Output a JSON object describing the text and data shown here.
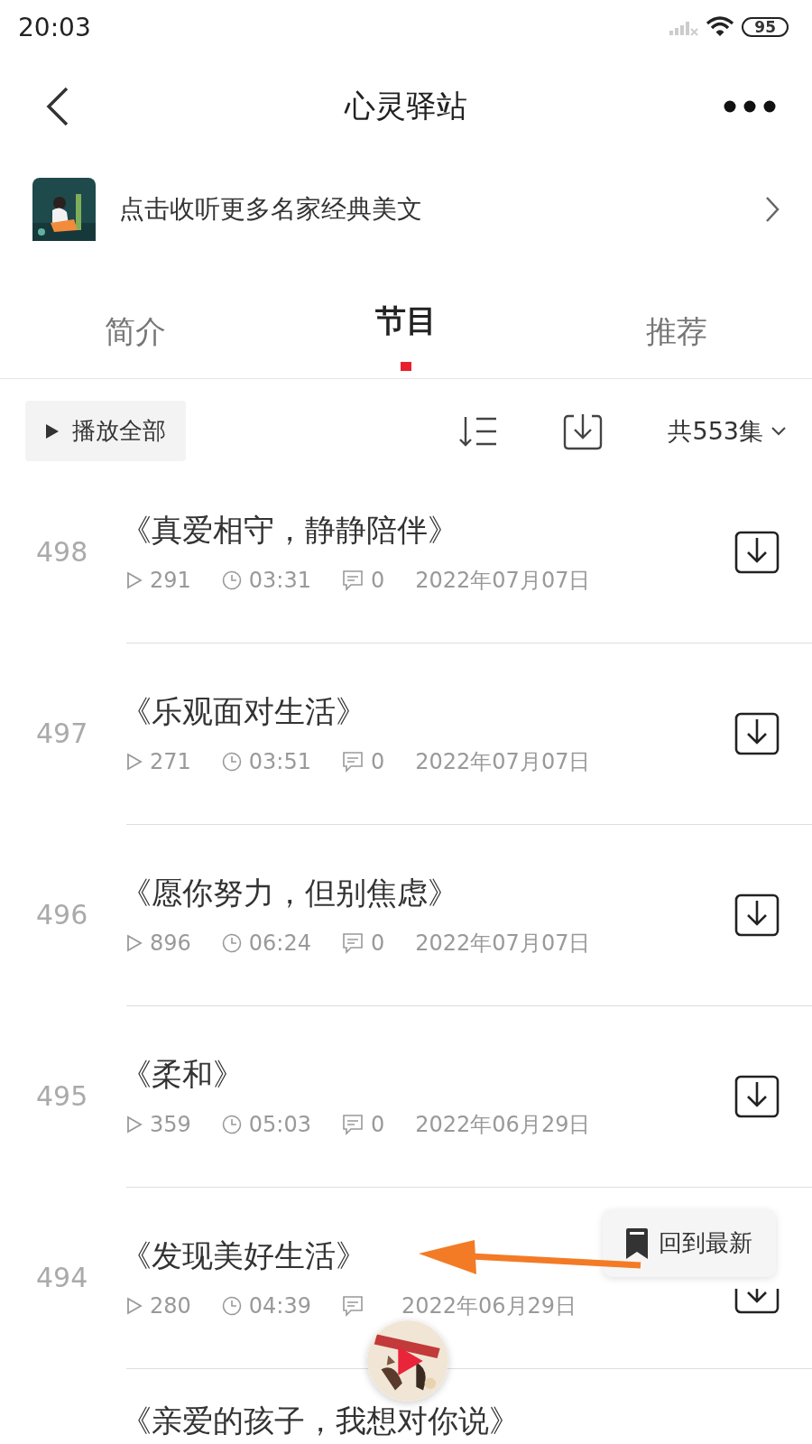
{
  "status_bar": {
    "time": "20:03",
    "battery": "95"
  },
  "nav": {
    "title": "心灵驿站"
  },
  "banner": {
    "text": "点击收听更多名家经典美文"
  },
  "tabs": [
    {
      "label": "简介",
      "selected": false
    },
    {
      "label": "节目",
      "selected": true
    },
    {
      "label": "推荐",
      "selected": false
    }
  ],
  "toolbar": {
    "play_all": "播放全部",
    "count": "共553集"
  },
  "episodes": [
    {
      "number": "498",
      "title": "《真爱相守，静静陪伴》",
      "plays": "291",
      "duration": "03:31",
      "comments": "0",
      "date": "2022年07月07日"
    },
    {
      "number": "497",
      "title": "《乐观面对生活》",
      "plays": "271",
      "duration": "03:51",
      "comments": "0",
      "date": "2022年07月07日"
    },
    {
      "number": "496",
      "title": "《愿你努力，但别焦虑》",
      "plays": "896",
      "duration": "06:24",
      "comments": "0",
      "date": "2022年07月07日"
    },
    {
      "number": "495",
      "title": "《柔和》",
      "plays": "359",
      "duration": "05:03",
      "comments": "0",
      "date": "2022年06月29日"
    },
    {
      "number": "494",
      "title": "《发现美好生活》",
      "plays": "280",
      "duration": "04:39",
      "date": "2022年06月29日",
      "download_clipped": true
    },
    {
      "title": "《亲爱的孩子，我想对你说》"
    }
  ],
  "float_button": {
    "label": "回到最新"
  }
}
